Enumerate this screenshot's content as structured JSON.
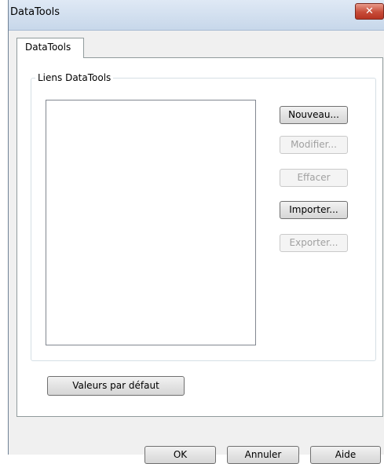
{
  "window": {
    "title": "DataTools"
  },
  "tabs": [
    {
      "label": "DataTools"
    }
  ],
  "group": {
    "label": "Liens DataTools"
  },
  "side_buttons": {
    "new": "Nouveau...",
    "modify": "Modifier...",
    "delete": "Effacer",
    "import": "Importer...",
    "export": "Exporter..."
  },
  "defaults_button": "Valeurs par défaut",
  "footer": {
    "ok": "OK",
    "cancel": "Annuler",
    "help": "Aide"
  },
  "close_glyph": "✕"
}
